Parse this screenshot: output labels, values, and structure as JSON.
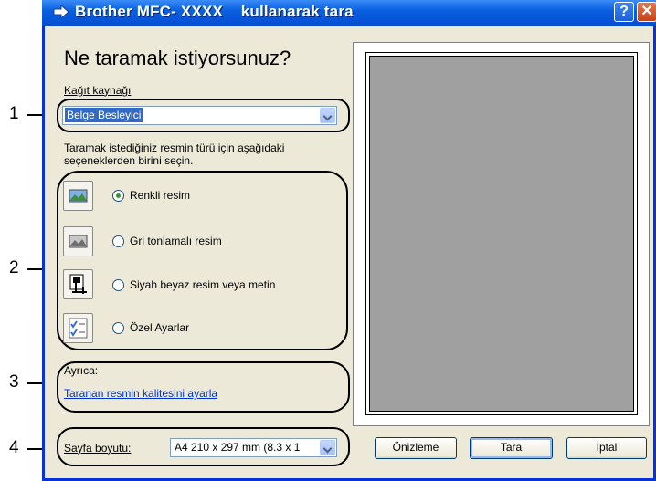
{
  "window": {
    "title": "Brother MFC- XXXX    kullanarak tara",
    "help_label": "?",
    "close_label": "✕"
  },
  "heading": "Ne taramak istiyorsunuz?",
  "paper_source": {
    "label": "Kağıt kaynağı",
    "value": "Belge Besleyici"
  },
  "instruction_line1": "Taramak istediğiniz resmin türü için aşağıdaki",
  "instruction_line2": "seçeneklerden birini seçin.",
  "options": [
    {
      "label": "Renkli resim",
      "icon": "color-photo-icon",
      "selected": true
    },
    {
      "label": "Gri tonlamalı resim",
      "icon": "grayscale-photo-icon",
      "selected": false
    },
    {
      "label": "Siyah beyaz resim veya metin",
      "icon": "black-white-text-icon",
      "selected": false
    },
    {
      "label": "Özel Ayarlar",
      "icon": "custom-settings-icon",
      "selected": false
    }
  ],
  "also": {
    "label": "Ayrıca:",
    "link": "Taranan resmin kalitesini ayarla"
  },
  "page_size": {
    "label": "Sayfa boyutu:",
    "value": "A4 210 x 297 mm (8.3 x 1"
  },
  "buttons": {
    "preview": "Önizleme",
    "scan": "Tara",
    "cancel": "İptal"
  },
  "callouts": [
    "1",
    "2",
    "3",
    "4"
  ],
  "colors": {
    "titlebar": "#0a5fe0",
    "dialog_bg": "#ece9d8",
    "preview_area": "#a0a0a0",
    "link": "#0033cc",
    "selection": "#316ac5"
  }
}
